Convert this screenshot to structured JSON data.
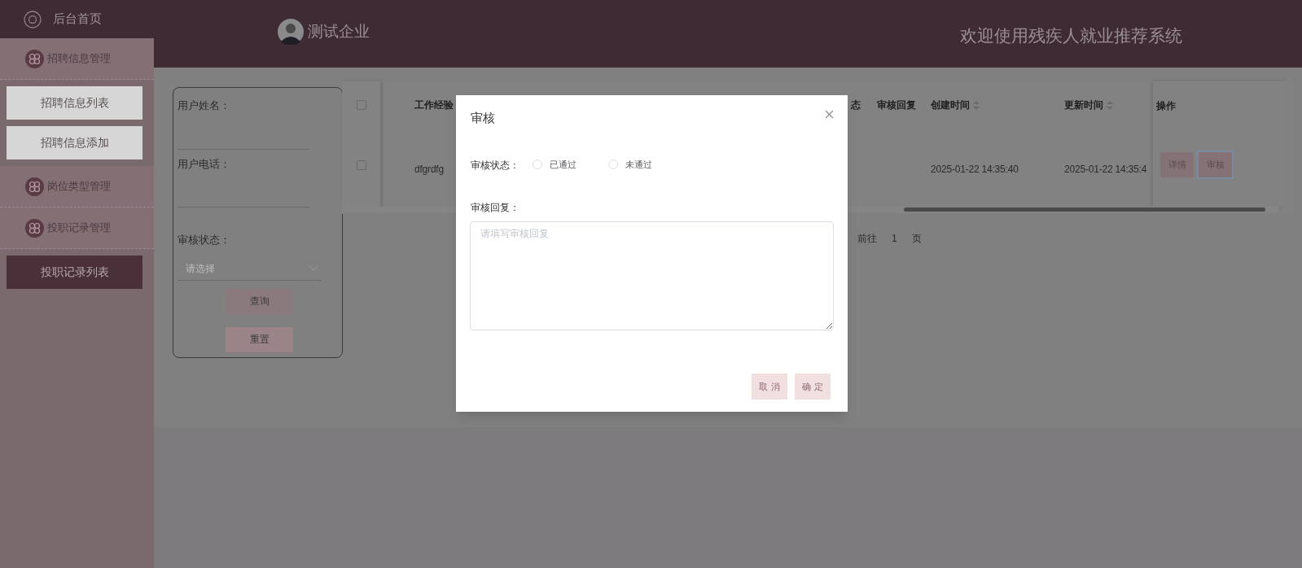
{
  "sidebar": {
    "items": [
      {
        "label": "后台首页",
        "kind": "home"
      },
      {
        "label": "招聘信息管理",
        "kind": "group",
        "children": [
          {
            "label": "招聘信息列表",
            "selected": false
          },
          {
            "label": "招聘信息添加",
            "selected": false
          }
        ]
      },
      {
        "label": "岗位类型管理",
        "kind": "group"
      },
      {
        "label": "投职记录管理",
        "kind": "group",
        "children": [
          {
            "label": "投职记录列表",
            "selected": true
          }
        ]
      }
    ]
  },
  "header": {
    "user": "测试企业",
    "welcome": "欢迎使用残疾人就业推荐系统"
  },
  "filters": [
    {
      "label": "用户姓名：",
      "kind": "text"
    },
    {
      "label": "用户电话：",
      "kind": "text"
    },
    {
      "label": "审核状态：",
      "kind": "select",
      "placeholder": "请选择"
    }
  ],
  "filter_buttons": [
    "查询",
    "重置"
  ],
  "table": {
    "columns": [
      {
        "label": "工作经验",
        "sortable": false
      },
      {
        "label": "态",
        "sortable": false
      },
      {
        "label": "审核回复",
        "sortable": false
      },
      {
        "label": "创建时间",
        "sortable": true
      },
      {
        "label": "更新时间",
        "sortable": true
      }
    ],
    "action_column": "操作",
    "rows": [
      {
        "checked": false,
        "cells": [
          "dfgrdfg",
          "",
          "",
          "2025-01-22 14:35:40",
          "2025-01-22 14:35:4"
        ],
        "actions": [
          "详情",
          "审核"
        ]
      }
    ],
    "header_checked": false
  },
  "pagination": {
    "goto": "前往",
    "page": "1",
    "suffix": "页"
  },
  "dialog": {
    "title": "审核",
    "status_label": "审核状态：",
    "options": [
      {
        "label": "已通过",
        "selected": false
      },
      {
        "label": "未通过",
        "selected": false
      }
    ],
    "reply_label": "审核回复：",
    "reply_placeholder": "请填写审核回复",
    "buttons": [
      "取 消",
      "确 定"
    ]
  }
}
